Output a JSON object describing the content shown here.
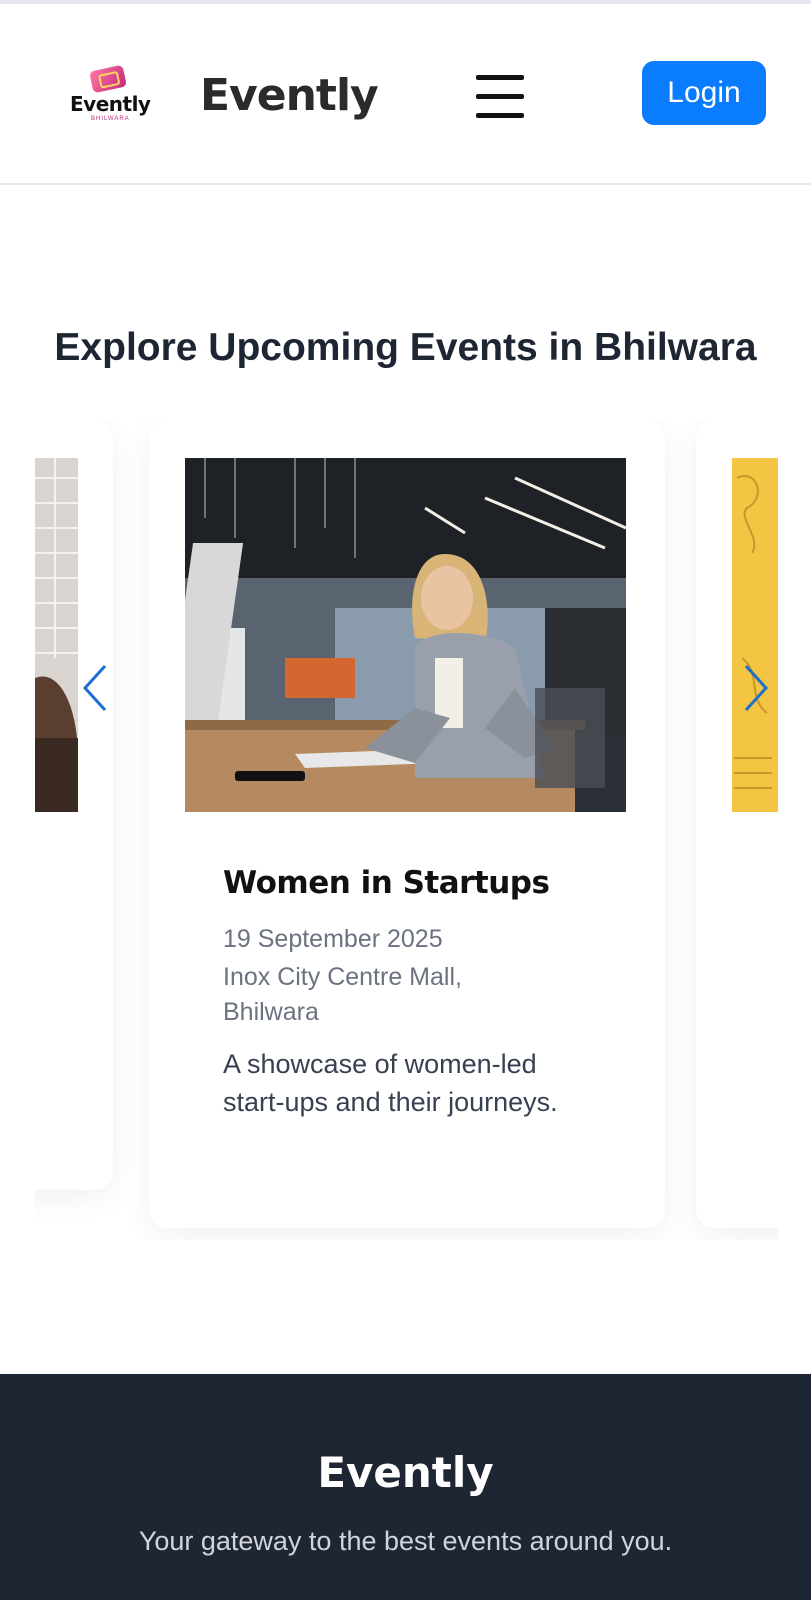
{
  "header": {
    "logo_text": "Evently",
    "logo_subtext": "BHILWARA",
    "brand": "Evently",
    "login_label": "Login"
  },
  "main": {
    "section_title": "Explore Upcoming Events in Bhilwara"
  },
  "carousel": {
    "active_card": {
      "title": "Women in Startups",
      "date": "19 September 2025",
      "venue": "Inox City Centre Mall, Bhilwara",
      "description": "A showcase of women-led start-ups and their journeys."
    }
  },
  "footer": {
    "brand": "Evently",
    "tagline": "Your gateway to the best events around you."
  },
  "colors": {
    "accent": "#0a7cff",
    "footer_bg": "#1f2633",
    "arrow": "#1a6fd1"
  }
}
